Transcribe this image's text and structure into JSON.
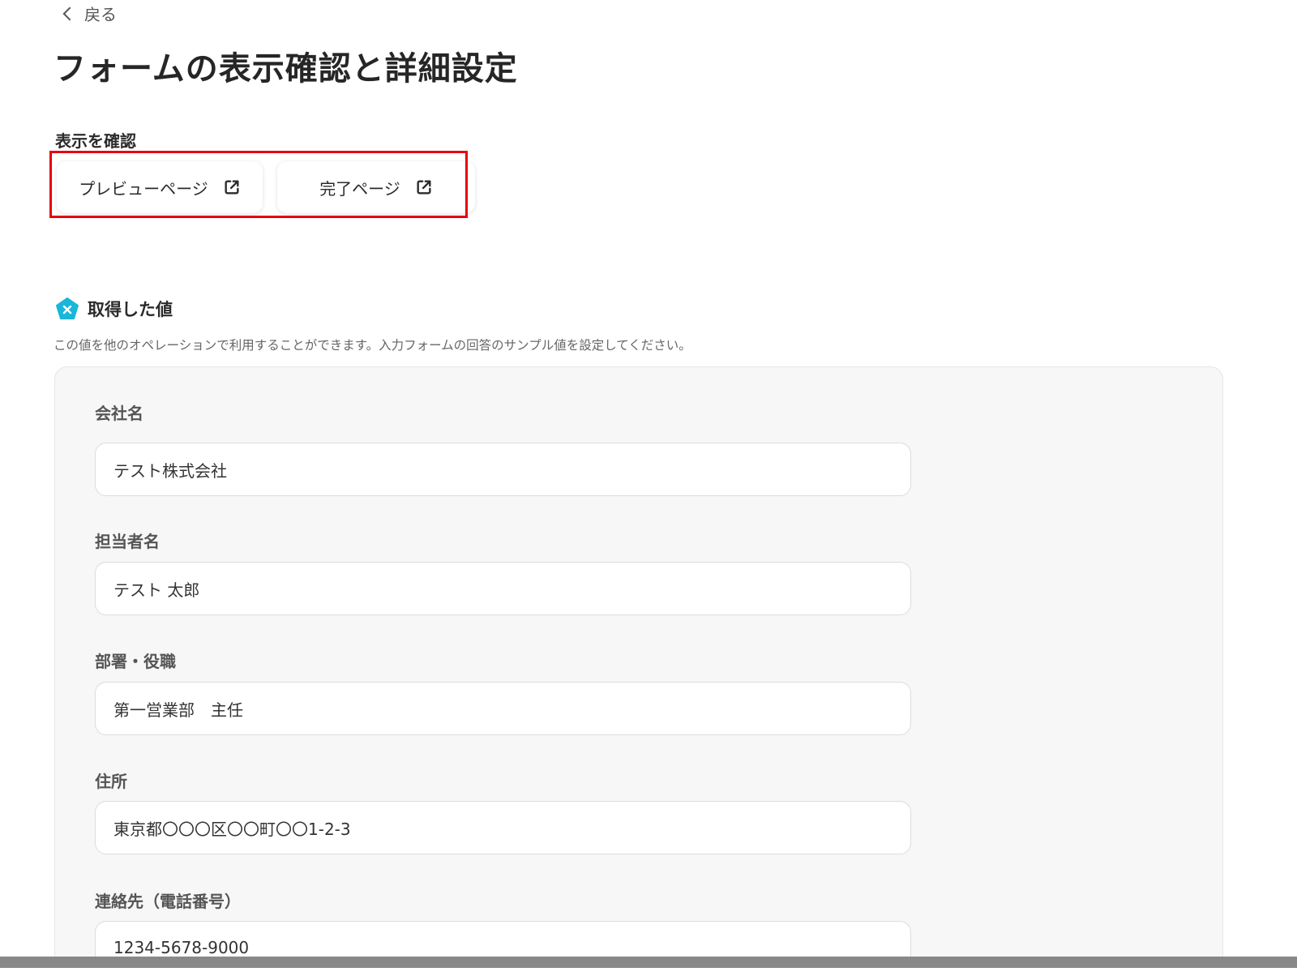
{
  "nav": {
    "back_label": "戻る"
  },
  "header": {
    "title": "フォームの表示確認と詳細設定"
  },
  "preview_section": {
    "label": "表示を確認",
    "preview_button": "プレビューページ",
    "complete_button": "完了ページ"
  },
  "values_section": {
    "heading": "取得した値",
    "description": "この値を他のオペレーションで利用することができます。入力フォームの回答のサンプル値を設定してください。"
  },
  "fields": [
    {
      "label": "会社名",
      "value": "テスト株式会社"
    },
    {
      "label": "担当者名",
      "value": "テスト 太郎"
    },
    {
      "label": "部署・役職",
      "value": "第一営業部　主任"
    },
    {
      "label": "住所",
      "value": "東京都〇〇〇区〇〇町〇〇1-2-3"
    },
    {
      "label": "連絡先（電話番号）",
      "value": "1234-5678-9000"
    }
  ],
  "colors": {
    "highlight": "#e60012",
    "badge": "#1ab6d9"
  },
  "icons": {
    "back": "chevron-left-icon",
    "external": "external-link-icon",
    "badge": "pentagon-badge-icon"
  }
}
